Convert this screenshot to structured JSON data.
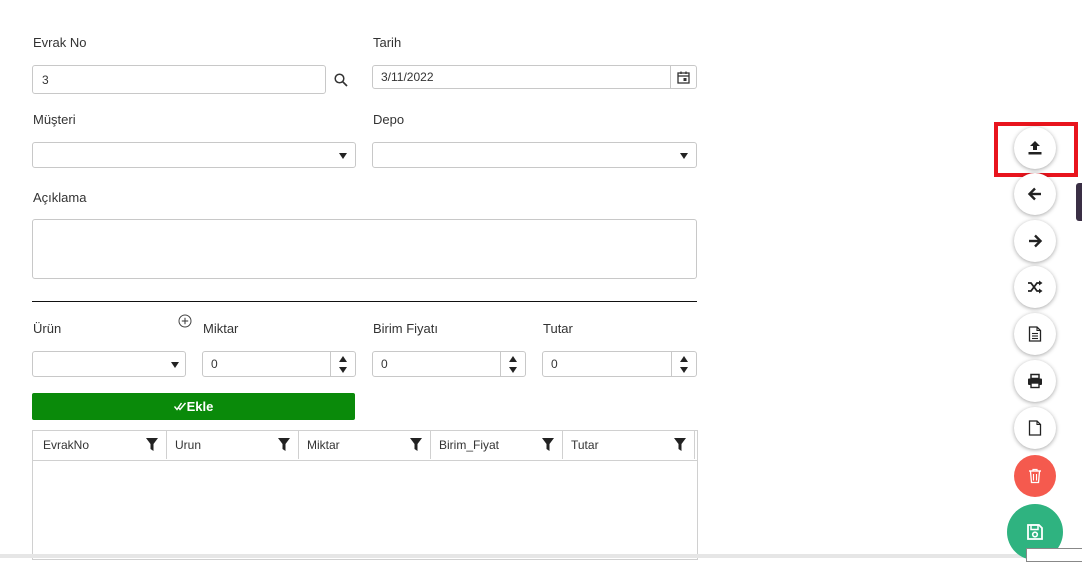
{
  "form": {
    "evrak_no": {
      "label": "Evrak No",
      "value": "3"
    },
    "tarih": {
      "label": "Tarih",
      "value": "3/11/2022"
    },
    "musteri": {
      "label": "Müşteri",
      "value": ""
    },
    "depo": {
      "label": "Depo",
      "value": ""
    },
    "aciklama": {
      "label": "Açıklama",
      "value": ""
    }
  },
  "line_entry": {
    "urun": {
      "label": "Ürün",
      "value": ""
    },
    "miktar": {
      "label": "Miktar",
      "value": "0"
    },
    "birim_fiyati": {
      "label": "Birim Fiyatı",
      "value": "0"
    },
    "tutar": {
      "label": "Tutar",
      "value": "0"
    },
    "add_button": "Ekle"
  },
  "grid": {
    "columns": [
      "EvrakNo",
      "Urun",
      "Miktar",
      "Birim_Fiyat",
      "Tutar"
    ],
    "rows": []
  },
  "toolbar": {
    "buttons": [
      {
        "icon": "upload-icon",
        "color": "#ffffff",
        "highlighted": true
      },
      {
        "icon": "arrow-left-icon",
        "color": "#ffffff"
      },
      {
        "icon": "arrow-right-icon",
        "color": "#ffffff"
      },
      {
        "icon": "shuffle-icon",
        "color": "#ffffff"
      },
      {
        "icon": "document-lines-icon",
        "color": "#ffffff"
      },
      {
        "icon": "print-icon",
        "color": "#ffffff"
      },
      {
        "icon": "new-document-icon",
        "color": "#ffffff"
      },
      {
        "icon": "trash-icon",
        "color": "#f55a4e"
      },
      {
        "icon": "save-icon",
        "color": "#2fb380"
      }
    ],
    "highlight_color": "#e8141d"
  },
  "colors": {
    "add_button": "#0a8a0a",
    "accent": "#0a8a0a"
  }
}
